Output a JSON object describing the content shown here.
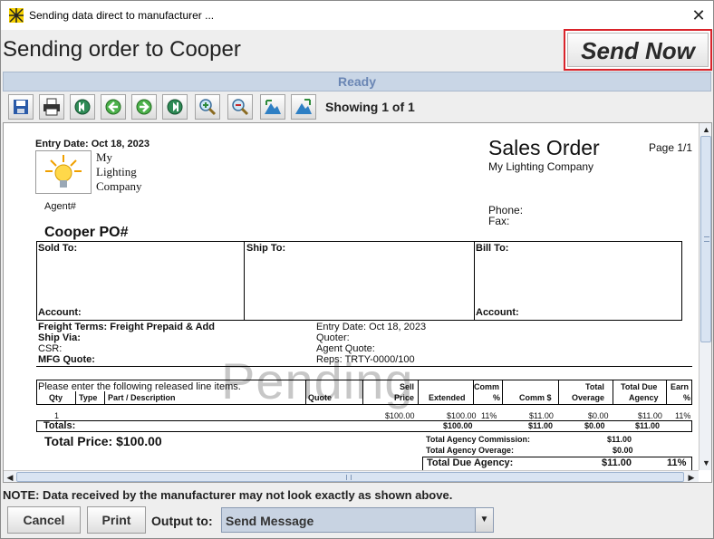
{
  "window": {
    "title": "Sending data direct to manufacturer ...",
    "close_glyph": "✕"
  },
  "heading": "Sending order to Cooper",
  "send_now_label": "Send Now",
  "status_text": "Ready",
  "toolbar": {
    "buttons": [
      "save-icon",
      "print-icon",
      "first-page-icon",
      "previous-page-icon",
      "next-page-icon",
      "last-page-icon",
      "zoom-in-icon",
      "zoom-out-icon",
      "fit-width-icon",
      "fit-page-icon"
    ],
    "showing": "Showing 1 of 1"
  },
  "document": {
    "entry_date_top": "Entry Date: Oct 18, 2023",
    "company_logo_text": [
      "My",
      "Lighting",
      "Company"
    ],
    "agent": "Agent#",
    "doc_title": "Sales Order",
    "company_name": "My Lighting Company",
    "page": "Page 1/1",
    "phone": "Phone:",
    "fax": "Fax:",
    "po": "Cooper PO#",
    "sold_to": "Sold To:",
    "ship_to": "Ship To:",
    "bill_to": "Bill To:",
    "account_left": "Account:",
    "account_right": "Account:",
    "freight_terms": "Freight Terms: Freight Prepaid & Add",
    "ship_via": "Ship Via:",
    "csr": "CSR:",
    "mfg_quote": "MFG Quote:",
    "entry_date_mid": "Entry Date: Oct 18, 2023",
    "quoter": "Quoter:",
    "agent_quote": "Agent Quote:",
    "reps": "Reps: TRTY-0000/100",
    "watermark": "Pending",
    "release_note": "Please enter the following released line items.",
    "columns": {
      "qty": "Qty",
      "type": "Type",
      "part": "Part / Description",
      "quote": "Quote",
      "sell1": "Sell",
      "sell2": "Price",
      "extended": "Extended",
      "comm1": "Comm",
      "comm2": "%",
      "comm_dollar": "Comm $",
      "total1": "Total",
      "total2": "Overage",
      "due1": "Total Due",
      "due2": "Agency",
      "earn1": "Earn",
      "earn2": "%"
    },
    "line": {
      "qty": "1",
      "sell": "$100.00",
      "extended": "$100.00",
      "comm_pct": "11%",
      "comm_dollar": "$11.00",
      "overage": "$0.00",
      "due": "$11.00",
      "earn": "11%"
    },
    "totals": {
      "label": "Totals:",
      "extended": "$100.00",
      "comm": "$11.00",
      "overage": "$0.00",
      "due": "$11.00"
    },
    "total_price": "Total Price: $100.00",
    "summary": {
      "commission_label": "Total Agency Commission:",
      "commission": "$11.00",
      "overage_label": "Total Agency Overage:",
      "overage": "$0.00",
      "due_label": "Total Due Agency:",
      "due": "$11.00",
      "due_pct": "11%"
    }
  },
  "note": "NOTE: Data received by the manufacturer may not look exactly as shown above.",
  "buttons": {
    "cancel": "Cancel",
    "print": "Print"
  },
  "output": {
    "label": "Output to:",
    "value": "Send Message"
  }
}
